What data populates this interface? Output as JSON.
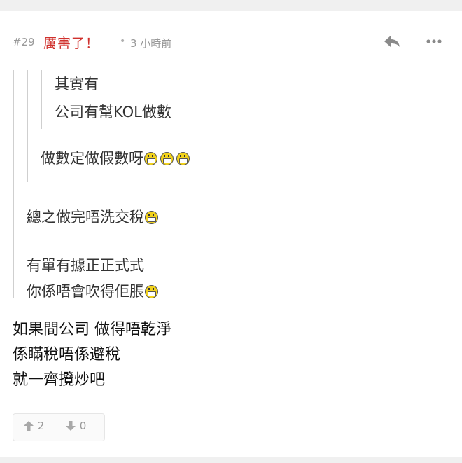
{
  "post": {
    "number": "#29",
    "author": "厲害了！",
    "separator": "•",
    "time": "3 小時前"
  },
  "icons": {
    "reply": "reply-icon",
    "more": "more-options-icon",
    "upvote": "arrow-up-icon",
    "downvote": "arrow-down-icon",
    "emoji": "grin-emoji-icon"
  },
  "quotes": {
    "level3": [
      "其實有",
      "公司有幫KOL做數"
    ],
    "level2": "做數定做假數呀",
    "level1_a": "總之做完唔洗交稅",
    "level1_b": [
      "有單有據正正式式",
      "你係唔會吹得佢脹"
    ]
  },
  "body": [
    "如果間公司 做得唔乾淨",
    "係瞞稅唔係避稅",
    "就一齊攬炒吧"
  ],
  "votes": {
    "up": "2",
    "down": "0"
  },
  "colors": {
    "author": "#d0312d",
    "muted": "#9a9a9a"
  }
}
